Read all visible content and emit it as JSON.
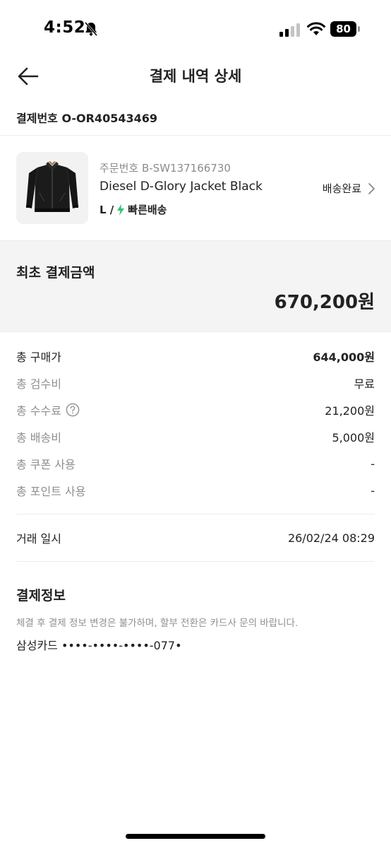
{
  "status_bar": {
    "time": "4:52",
    "battery": "80"
  },
  "nav": {
    "title": "결제 내역 상세"
  },
  "payment": {
    "label": "결제번호",
    "number": "O-OR40543469"
  },
  "product": {
    "order_no": "주문번호 B-SW137166730",
    "name": "Diesel D-Glory Jacket Black",
    "size": "L /",
    "shipping_type": "빠른배송",
    "status": "배송완료"
  },
  "total": {
    "label": "최초 결제금액",
    "amount": "670,200원"
  },
  "details": [
    {
      "label": "총 구매가",
      "value": "644,000원"
    },
    {
      "label": "총 검수비",
      "value": "무료"
    },
    {
      "label": "총 수수료",
      "value": "21,200원"
    },
    {
      "label": "총 배송비",
      "value": "5,000원"
    },
    {
      "label": "총 쿠폰 사용",
      "value": "-"
    },
    {
      "label": "총 포인트 사용",
      "value": "-"
    }
  ],
  "transaction": {
    "label": "거래 일시",
    "value": "26/02/24 08:29"
  },
  "payment_info": {
    "title": "결제정보",
    "notice": "체결 후 결제 정보 변경은 불가하며, 할부 전환은 카드사 문의 바랍니다.",
    "card": "삼성카드 ••••-••••-••••-077•"
  },
  "colors": {
    "accent_green": "#31c46c",
    "muted": "#8f8f8f",
    "box_bg": "#f4f4f4"
  }
}
